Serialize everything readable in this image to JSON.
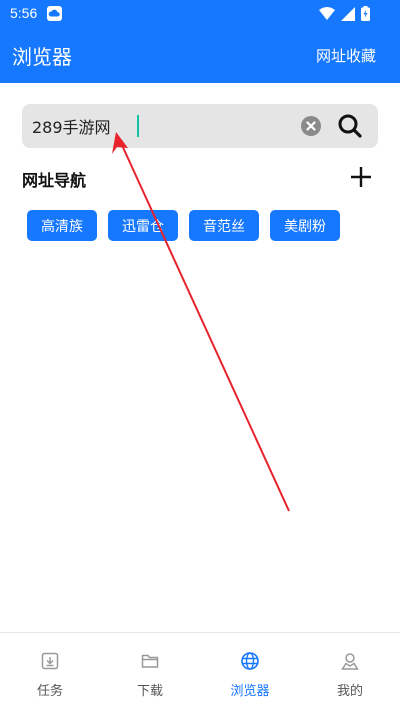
{
  "status_bar": {
    "time": "5:56"
  },
  "app_bar": {
    "title": "浏览器",
    "action": "网址收藏"
  },
  "search": {
    "value": "289手游网"
  },
  "nav_section": {
    "title": "网址导航",
    "chips": [
      "高清族",
      "迅雷仓",
      "音范丝",
      "美剧粉"
    ]
  },
  "bottom_nav": {
    "items": [
      {
        "label": "任务",
        "icon": "download-box-icon"
      },
      {
        "label": "下载",
        "icon": "folder-icon"
      },
      {
        "label": "浏览器",
        "icon": "globe-icon",
        "active": true
      },
      {
        "label": "我的",
        "icon": "person-icon"
      }
    ]
  },
  "colors": {
    "primary": "#1677ff",
    "annotation_arrow": "#e8232b",
    "caret": "#13c2a5"
  }
}
